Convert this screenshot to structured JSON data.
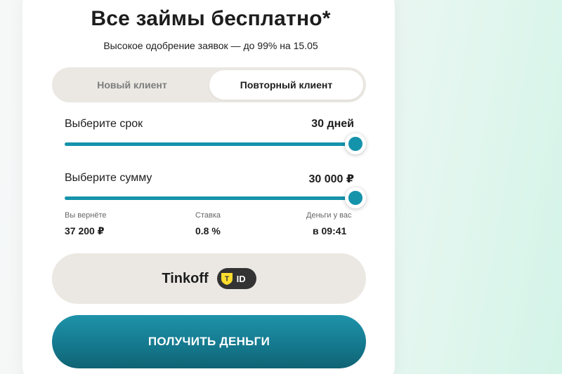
{
  "header": {
    "title": "Все займы бесплатно*",
    "subtitle": "Высокое одобрение заявок — до 99% на 15.05"
  },
  "tabs": [
    {
      "label": "Новый клиент",
      "active": false
    },
    {
      "label": "Повторный клиент",
      "active": true
    }
  ],
  "term": {
    "label": "Выберите срок",
    "value": "30 дней",
    "slider_fraction": 1.0
  },
  "amount": {
    "label": "Выберите сумму",
    "value": "30 000 ₽",
    "slider_fraction": 1.0
  },
  "summary": [
    {
      "caption": "Вы вернёте",
      "value": "37 200 ₽"
    },
    {
      "caption": "Ставка",
      "value": "0.8 %"
    },
    {
      "caption": "Деньги у вас",
      "value": "в 09:41"
    }
  ],
  "tinkoff": {
    "label": "Tinkoff",
    "badge_text": "ID",
    "badge_letter": "T"
  },
  "cta": {
    "label": "ПОЛУЧИТЬ ДЕНЬГИ"
  },
  "colors": {
    "accent": "#1593ab",
    "tab_bg": "#ebe8e3",
    "badge_yellow": "#ffdd2d"
  },
  "icons": {
    "slider_knob": "circle-knob",
    "tinkoff_id": "tinkoff-shield-icon"
  }
}
